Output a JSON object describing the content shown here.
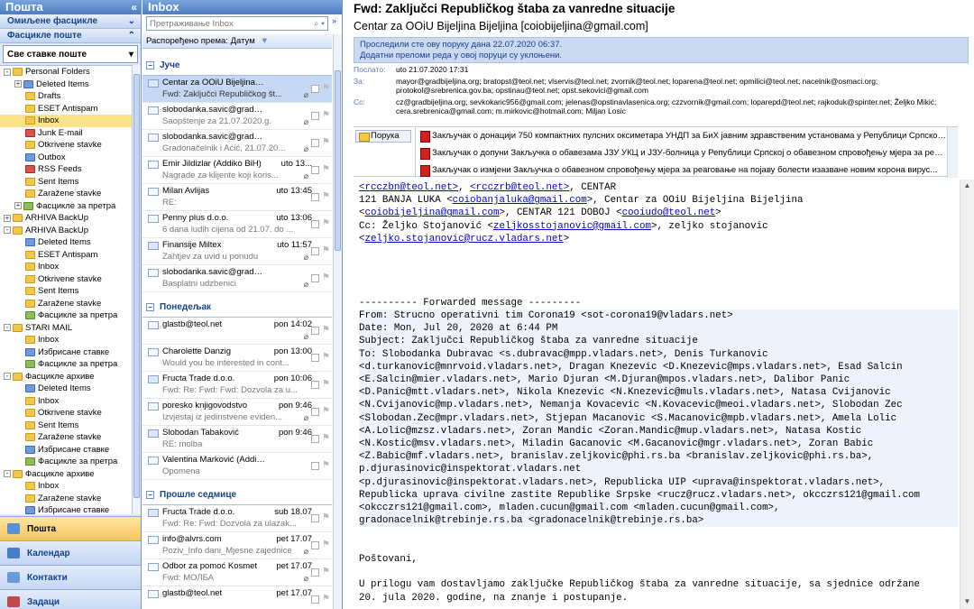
{
  "nav": {
    "title": "Пошта",
    "collapse": "«",
    "favorites_header": "Омиљене фасцикле",
    "mail_folders_header": "Фасцикле поште",
    "all_items": "Све ставке поште",
    "tree": [
      {
        "label": "Personal Folders",
        "indent": 0,
        "exp": "-",
        "icon": "f-y"
      },
      {
        "label": "Deleted Items",
        "indent": 1,
        "exp": "+",
        "icon": "f-b"
      },
      {
        "label": "Drafts",
        "indent": 1,
        "exp": "",
        "icon": "f-y"
      },
      {
        "label": "ESET Antispam",
        "indent": 1,
        "exp": "",
        "icon": "f-y"
      },
      {
        "label": "Inbox",
        "indent": 1,
        "exp": "",
        "icon": "f-y",
        "sel": true
      },
      {
        "label": "Junk E-mail",
        "indent": 1,
        "exp": "",
        "icon": "f-r"
      },
      {
        "label": "Otkrivene stavke",
        "indent": 1,
        "exp": "",
        "icon": "f-y"
      },
      {
        "label": "Outbox",
        "indent": 1,
        "exp": "",
        "icon": "f-b"
      },
      {
        "label": "RSS Feeds",
        "indent": 1,
        "exp": "",
        "icon": "f-r"
      },
      {
        "label": "Sent Items",
        "indent": 1,
        "exp": "",
        "icon": "f-y"
      },
      {
        "label": "Zaražene stavke",
        "indent": 1,
        "exp": "",
        "icon": "f-y"
      },
      {
        "label": "Фасцикле за претра",
        "indent": 1,
        "exp": "+",
        "icon": "f-g"
      },
      {
        "label": "ARHIVA BackUp",
        "indent": 0,
        "exp": "+",
        "icon": "f-y"
      },
      {
        "label": "ARHIVA BackUp",
        "indent": 0,
        "exp": "-",
        "icon": "f-y"
      },
      {
        "label": "Deleted Items",
        "indent": 1,
        "exp": "",
        "icon": "f-b"
      },
      {
        "label": "ESET Antispam",
        "indent": 1,
        "exp": "",
        "icon": "f-y"
      },
      {
        "label": "Inbox",
        "indent": 1,
        "exp": "",
        "icon": "f-y"
      },
      {
        "label": "Otkrivene stavke",
        "indent": 1,
        "exp": "",
        "icon": "f-y"
      },
      {
        "label": "Sent Items",
        "indent": 1,
        "exp": "",
        "icon": "f-y"
      },
      {
        "label": "Zaražene stavke",
        "indent": 1,
        "exp": "",
        "icon": "f-y"
      },
      {
        "label": "Фасцикле за претра",
        "indent": 1,
        "exp": "",
        "icon": "f-g"
      },
      {
        "label": "STARI MAIL",
        "indent": 0,
        "exp": "-",
        "icon": "f-y"
      },
      {
        "label": "Inbox",
        "indent": 1,
        "exp": "",
        "icon": "f-y"
      },
      {
        "label": "Избрисане ставке",
        "indent": 1,
        "exp": "",
        "icon": "f-b"
      },
      {
        "label": "Фасцикле за претра",
        "indent": 1,
        "exp": "",
        "icon": "f-g"
      },
      {
        "label": "Фасцикле архиве",
        "indent": 0,
        "exp": "-",
        "icon": "f-y"
      },
      {
        "label": "Deleted Items",
        "indent": 1,
        "exp": "",
        "icon": "f-b"
      },
      {
        "label": "Inbox",
        "indent": 1,
        "exp": "",
        "icon": "f-y"
      },
      {
        "label": "Otkrivene stavke",
        "indent": 1,
        "exp": "",
        "icon": "f-y"
      },
      {
        "label": "Sent Items",
        "indent": 1,
        "exp": "",
        "icon": "f-y"
      },
      {
        "label": "Zaražene stavke",
        "indent": 1,
        "exp": "",
        "icon": "f-y"
      },
      {
        "label": "Избрисане ставке",
        "indent": 1,
        "exp": "",
        "icon": "f-b"
      },
      {
        "label": "Фасцикле за претра",
        "indent": 1,
        "exp": "",
        "icon": "f-g"
      },
      {
        "label": "Фасцикле архиве",
        "indent": 0,
        "exp": "-",
        "icon": "f-y"
      },
      {
        "label": "Inbox",
        "indent": 1,
        "exp": "",
        "icon": "f-y"
      },
      {
        "label": "Zaražene stavke",
        "indent": 1,
        "exp": "",
        "icon": "f-y"
      },
      {
        "label": "Избрисане ставке",
        "indent": 1,
        "exp": "",
        "icon": "f-b"
      }
    ],
    "buttons": [
      {
        "label": "Пошта",
        "active": true,
        "color": "#5b8fd6"
      },
      {
        "label": "Календар",
        "active": false,
        "color": "#4a7fc8"
      },
      {
        "label": "Контакти",
        "active": false,
        "color": "#6b9ad8"
      },
      {
        "label": "Задаци",
        "active": false,
        "color": "#c04a4a"
      }
    ]
  },
  "list": {
    "title": "Inbox",
    "search_placeholder": "Претраживање Inbox",
    "arranged_by": "Распоређено према: Датум",
    "groups": [
      {
        "label": "Јуче",
        "messages": [
          {
            "sender": "Centar za OOiU Bijeljina Bijeljina",
            "date": "",
            "preview": "Fwd: Zaključci Republičkog št...",
            "sel": true,
            "att": true,
            "fw": true
          },
          {
            "sender": "slobodanka.savic@gradzvornik....",
            "date": "",
            "preview": "Saopštenje za 21.07.2020.g.",
            "att": true
          },
          {
            "sender": "slobodanka.savic@gradzvornik....",
            "date": "",
            "preview": "Gradonačelnik i Aćić, 21.07.20...",
            "att": true
          },
          {
            "sender": "Emir Jildizlar (Addiko BiH)",
            "date": "uto 13...",
            "preview": "Nagrade za klijente koji koris...",
            "att": true
          },
          {
            "sender": "Milan Avlijas",
            "date": "uto 13:45",
            "preview": "RE:"
          },
          {
            "sender": "Penny plus d.o.o.",
            "date": "uto 13:06",
            "preview": "6 dana ludih cijena od 21.07. do ..."
          },
          {
            "sender": "Finansije Miltex",
            "date": "uto 11:57",
            "preview": "Zahtjev za uvid u ponudu",
            "att": true,
            "fw": true
          },
          {
            "sender": "slobodanka.savic@gradzvornik....",
            "date": "",
            "preview": "Basplatni udzbenici",
            "att": true
          }
        ]
      },
      {
        "label": "Понедељак",
        "messages": [
          {
            "sender": "glastb@teol.net",
            "date": "pon 14:02",
            "preview": "",
            "att": true
          },
          {
            "sender": "Charolette Danzig",
            "date": "pon 13:00",
            "preview": "Would you be interested in cont..."
          },
          {
            "sender": "Fructa Trade d.o.o.",
            "date": "pon 10:06",
            "preview": "Fwd: Re: Fwd: Fwd: Dozvola za u...",
            "fw": true
          },
          {
            "sender": "poresko knjigovodstvo",
            "date": "pon 9:46",
            "preview": "Izvjestaj iz jedinstvene eviden...",
            "att": true
          },
          {
            "sender": "Slobodan Tabaković",
            "date": "pon 9:46",
            "preview": "RE: molba",
            "fw": true
          },
          {
            "sender": "Valentina Marković (Addiko BiH)",
            "date": "",
            "preview": "Opomena"
          }
        ]
      },
      {
        "label": "Прошле седмице",
        "messages": [
          {
            "sender": "Fructa Trade d.o.o.",
            "date": "sub 18.07",
            "preview": "Fwd: Re: Fwd: Dozvola za ulazak...",
            "fw": true
          },
          {
            "sender": "info@alvrs.com",
            "date": "pet 17.07",
            "preview": "Poziv_Info dani_Mjesne zajednice",
            "att": true
          },
          {
            "sender": "Odbor za pomoć Kosmet",
            "date": "pet 17.07",
            "preview": "Fwd: МОЛБА",
            "att": true
          },
          {
            "sender": "glastb@teol.net",
            "date": "pet 17.07",
            "preview": ""
          }
        ]
      }
    ]
  },
  "reading": {
    "subject": "Fwd: Zaključci Republičkog štaba za vanredne situacije",
    "from": "Centar za OOiU Bijeljina Bijeljina [coiobijeljina@gmail.com]",
    "info1": "Проследили сте ову поруку дана 22.07.2020 06:37.",
    "info2": "Додатни преломи реда у овој поруци су уклоњени.",
    "sent_label": "Послато:",
    "sent_value": "uto 21.07.2020 17:31",
    "to_label": "За:",
    "to_value": "mayor@gradbijeljina.org; bratopst@teol.net; vlservis@teol.net; zvornik@teol.net; loparena@teol.net; opmilici@teol.net; nacelnik@osmaci.org; protokol@srebrenica.gov.ba; opstinau@teol.net; opst.sekovici@gmail.com",
    "cc_label": "Cc:",
    "cc_value": "cz@gradbijeljina.org; sevkokaric956@gmail.com; jelenas@opstinavlasenica.org; czzvornik@gmail.com; loparepd@teol.net; rajkoduk@spinter.net; Željko Mikić; cera.srebrenica@gmail.com; m.mirkovic@hotmail.com; Miljan Losic",
    "attach_button": "Порука",
    "attachments": [
      "Закључак о донацији 750 компактних пулсних оксиметара УНДП за БиХ јавним здравственим установама у Републици Српској ...",
      "Закључак о допуни Закључка о обавезама ЈЗУ УКЦ и ЈЗУ-болница у Републици Српској о обавезном спровођењу мјера за реаг...",
      "Закључак о измјени Закључка о обавезном спровођењу мјера за реаговање на појаву болести изазване новим корона вирус..."
    ],
    "body_top": [
      [
        [
          "a",
          "<rcczbn@teol.net>"
        ],
        [
          "t",
          ", "
        ],
        [
          "a",
          "<rcczrb@teol.net>"
        ],
        [
          "t",
          ", CENTAR"
        ]
      ],
      [
        [
          "t",
          "121 BANJA LUKA <"
        ],
        [
          "a",
          "coiobanjaluka@gmail.com"
        ],
        [
          "t",
          ">, Centar za OOiU Bijeljina Bijeljina"
        ]
      ],
      [
        [
          "t",
          "<"
        ],
        [
          "a",
          "coiobijeljina@gmail.com"
        ],
        [
          "t",
          ">, CENTAR 121 DOBOJ <"
        ],
        [
          "a",
          "cooiudo@teol.net"
        ],
        [
          "t",
          ">"
        ]
      ],
      [
        [
          "t",
          "Cc: Željko Stojanović <"
        ],
        [
          "a",
          "zeljkosstojanovic@gmail.com"
        ],
        [
          "t",
          ">, zeljko stojanovic"
        ]
      ],
      [
        [
          "t",
          "<"
        ],
        [
          "a",
          "zeljko.stojanovic@rucz.vladars.net"
        ],
        [
          "t",
          ">"
        ]
      ]
    ],
    "fwd_sep": "---------- Forwarded message ---------",
    "fwd_lines": [
      "From: Strucno operativni tim Corona19 <sot-corona19@vladars.net>",
      "Date: Mon, Jul 20, 2020 at 6:44 PM",
      "Subject: Zaključci Republičkog štaba za vanredne situacije",
      "To: Slobodanka Dubravac <s.dubravac@mpp.vladars.net>, Denis Turkanovic",
      "<d.turkanovic@mnrvoid.vladars.net>, Dragan Knezevic <D.Knezevic@mps.vladars.net>, Esad Salcin",
      "<E.Salcin@mier.vladars.net>, Mario Djuran <M.Djuran@mpos.vladars.net>, Dalibor Panic",
      "<D.Panic@mtt.vladars.net>, Nikola Knezevic <N.Knezevic@muls.vladars.net>, Natasa Cvijanovic",
      "<N.Cvijanovic@mp.vladars.net>, Nemanja Kovacevic <N.Kovacevic@meoi.vladars.net>, Slobodan Zec",
      "<Slobodan.Zec@mpr.vladars.net>, Stjepan Macanovic <S.Macanovic@mpb.vladars.net>, Amela Lolic",
      "<A.Lolic@mzsz.vladars.net>, Zoran Mandic <Zoran.Mandic@mup.vladars.net>, Natasa Kostic",
      "<N.Kostic@msv.vladars.net>, Miladin Gacanovic <M.Gacanovic@mgr.vladars.net>, Zoran Babic",
      "<Z.Babic@mf.vladars.net>, branislav.zeljkovic@phi.rs.ba <branislav.zeljkovic@phi.rs.ba>,",
      "p.djurasinovic@inspektorat.vladars.net",
      "<p.djurasinovic@inspektorat.vladars.net>, Republicka UIP <uprava@inspektorat.vladars.net>,",
      "Republicka uprava civilne zastite Republike Srpske <rucz@rucz.vladars.net>, okcczrs121@gmail.com",
      "<okcczrs121@gmail.com>, mladen.cucun@gmail.com <mladen.cucun@gmail.com>,",
      "gradonacelnik@trebinje.rs.ba <gradonacelnik@trebinje.rs.ba>"
    ],
    "greeting": "Poštovani,",
    "para1": "U prilogu vam dostavljamo zaključke Republičkog štaba za vanredne situacije, sa sjednice održane",
    "para2": "20. jula 2020. godine, na znanje i postupanje."
  }
}
